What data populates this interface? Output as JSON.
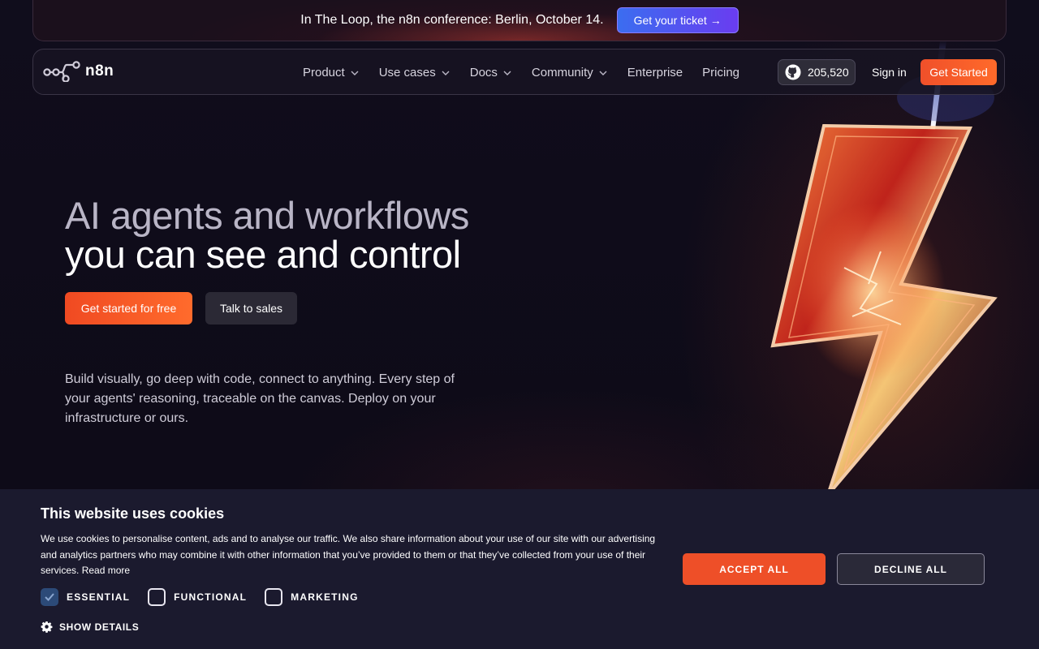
{
  "banner": {
    "text": "In The Loop, the n8n conference: Berlin, October 14.",
    "cta": "Get your ticket →"
  },
  "nav": {
    "logo": "n8n",
    "items": [
      {
        "label": "Product",
        "dropdown": true
      },
      {
        "label": "Use cases",
        "dropdown": true
      },
      {
        "label": "Docs",
        "dropdown": true
      },
      {
        "label": "Community",
        "dropdown": true
      },
      {
        "label": "Enterprise",
        "dropdown": false
      },
      {
        "label": "Pricing",
        "dropdown": false
      }
    ],
    "github_stars": "205,520",
    "sign_in": "Sign in",
    "get_started": "Get Started"
  },
  "hero": {
    "title_line1": "AI agents and workflows",
    "title_line2": "you can see and control",
    "primary_cta": "Get started for free",
    "secondary_cta": "Talk to sales",
    "description": "Build visually, go deep with code, connect to anything. Every step of your agents' reasoning, traceable on the canvas. Deploy on your infrastructure or ours."
  },
  "cookie": {
    "title": "This website uses cookies",
    "text": "We use cookies to personalise content, ads and to analyse our traffic. We also share information about your use of our site with our advertising and analytics partners who may combine it with other information that you’ve provided to them or that they’ve collected from your use of their services.",
    "read_more": "Read more",
    "accept": "ACCEPT ALL",
    "decline": "DECLINE ALL",
    "options": [
      {
        "label": "ESSENTIAL",
        "checked": true
      },
      {
        "label": "FUNCTIONAL",
        "checked": false
      },
      {
        "label": "MARKETING",
        "checked": false
      }
    ],
    "show_details": "SHOW DETAILS"
  },
  "colors": {
    "accent": "#ee4f28",
    "background": "#0e0b18",
    "cookie_bg": "#1b1a2e"
  }
}
